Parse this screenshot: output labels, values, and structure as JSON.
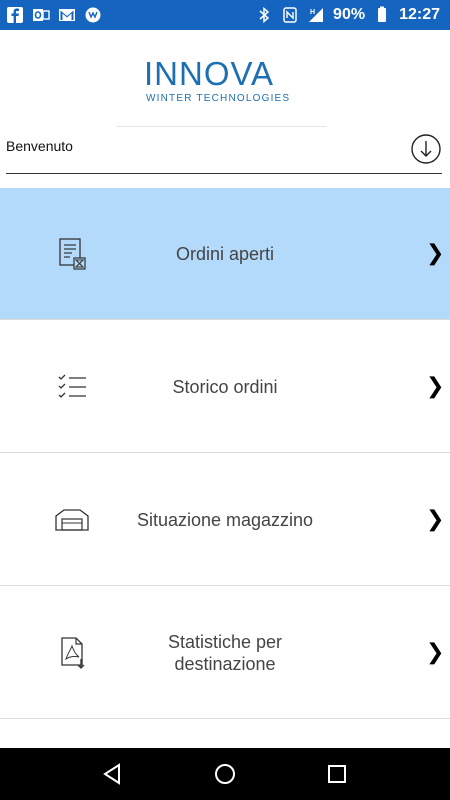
{
  "status_bar": {
    "left_icons": [
      "facebook-icon",
      "outlook-icon",
      "gmail-icon",
      "whatsapp-icon"
    ],
    "right_icons": [
      "bluetooth-icon",
      "nfc-icon",
      "signal-icon"
    ],
    "battery": "90%",
    "time": "12:27"
  },
  "logo": {
    "brand": "INNOVA",
    "tagline": "WINTER TECHNOLOGIES",
    "color": "#1d6fb3"
  },
  "welcome": {
    "text": "Benvenuto",
    "action_icon": "download-icon"
  },
  "menu": {
    "items": [
      {
        "label": "Ordini aperti",
        "icon": "document-hourglass-icon",
        "active": true
      },
      {
        "label": "Storico ordini",
        "icon": "checklist-icon",
        "active": false
      },
      {
        "label": "Situazione magazzino",
        "icon": "warehouse-icon",
        "active": false
      },
      {
        "label": "Statistiche per destinazione",
        "icon": "pdf-download-icon",
        "active": false
      }
    ],
    "chevron": "❯"
  },
  "colors": {
    "status_bar": "#1565c0",
    "active_item": "#b3d9fb",
    "navbar": "#000000"
  }
}
